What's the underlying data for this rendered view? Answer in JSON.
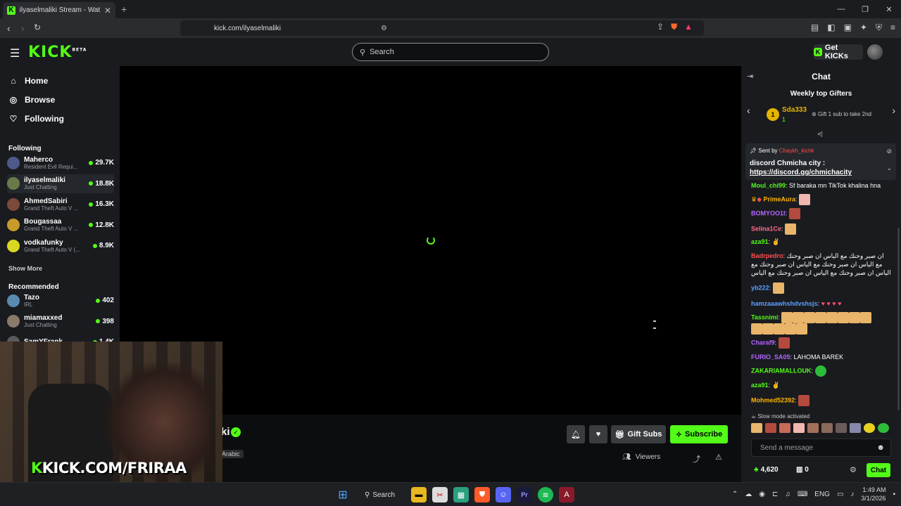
{
  "browser": {
    "tab_title": "ilyaselmaliki Stream - Watch Live",
    "url": "kick.com/ilyaselmaliki"
  },
  "header": {
    "logo_text": "KICK",
    "logo_badge": "BETA",
    "search_placeholder": "Search",
    "get_kicks_label": "Get KICKs"
  },
  "sidebar": {
    "nav": [
      {
        "label": "Home",
        "icon": "home-icon"
      },
      {
        "label": "Browse",
        "icon": "compass-icon"
      },
      {
        "label": "Following",
        "icon": "heart-icon"
      }
    ],
    "following_title": "Following",
    "following": [
      {
        "name": "Maherco",
        "game": "Resident Evil Requi...",
        "viewers": "29.7K",
        "color": "#4b5a8a"
      },
      {
        "name": "ilyaselmaliki",
        "game": "Just Chatting",
        "viewers": "18.8K",
        "color": "#6a7a4a"
      },
      {
        "name": "AhmedSabiri",
        "game": "Grand Theft Auto V ...",
        "viewers": "16.3K",
        "color": "#7a4a3a"
      },
      {
        "name": "Bougassaa",
        "game": "Grand Theft Auto V ...",
        "viewers": "12.8K",
        "color": "#c89a2a"
      },
      {
        "name": "vodkafunky",
        "game": "Grand Theft Auto V (...",
        "viewers": "8.9K",
        "color": "#d8d820"
      }
    ],
    "show_more": "Show More",
    "recommended_title": "Recommended",
    "recommended": [
      {
        "name": "Tazo",
        "game": "IRL",
        "viewers": "402",
        "color": "#5a8ab0"
      },
      {
        "name": "miamaxxed",
        "game": "Just Chatting",
        "viewers": "398",
        "color": "#8a7a6a"
      },
      {
        "name": "SamYFrank",
        "game": "",
        "viewers": "1.4K",
        "color": "#5a5a5a"
      }
    ]
  },
  "stream": {
    "name_visible": "ki",
    "language_tag": "Arabic",
    "gift_subs_label": "Gift Subs",
    "subscribe_label": "Subscribe",
    "viewers_label": "Viewers",
    "webcam_text_k": "K",
    "webcam_text": "KICK.COM/FRIRAA"
  },
  "chat": {
    "title": "Chat",
    "gifters_title": "Weekly top Gifters",
    "top_gifter": {
      "rank": "1",
      "name": "Sda333",
      "count": "1"
    },
    "gift_hint": "Gift 1 sub to take 2nd",
    "pinned": {
      "sent_by": "Sent by",
      "user": "Chaykh_kichk",
      "text": "discord Chmicha city :",
      "link": "https://discord.gg/chmichacity"
    },
    "messages": [
      {
        "user": "BOMYOO1I",
        "color": "#b366ff",
        "text": ""
      },
      {
        "user": "Moul_chi99",
        "color": "#53fc18",
        "text": "Sf baraka mn TikTok khalina hna"
      },
      {
        "user": "PrimeAura",
        "color": "#ffb400",
        "text": ""
      },
      {
        "user": "BOMYOO1I",
        "color": "#b366ff",
        "text": ""
      },
      {
        "user": "Selina1Ce",
        "color": "#ff6b8a",
        "text": ""
      },
      {
        "user": "aza91",
        "color": "#53fc18",
        "text": ""
      },
      {
        "user": "Badrpedro",
        "color": "#ff4d4d",
        "text": "ان صبر وحنك مع الياس ان صبر وحنك مع الياس ان صبر وحنك مع الياس ان صبر وحنك مع الياس ان صبر وحنك مع الياس ان صبر وحنك مع الياس"
      },
      {
        "user": "yb222",
        "color": "#5aa0ff",
        "text": ""
      },
      {
        "user": "hamzaaawhshdvshsjs",
        "color": "#5aa0ff",
        "text": ""
      },
      {
        "user": "Tassnimi",
        "color": "#53fc18",
        "text": ""
      },
      {
        "user": "Charaf9",
        "color": "#b366ff",
        "text": ""
      },
      {
        "user": "FURIO_SA05",
        "color": "#b366ff",
        "text": "LAHOMA BAREK"
      },
      {
        "user": "ZAKARIAMALLOUK",
        "color": "#53fc18",
        "text": ""
      },
      {
        "user": "aza91",
        "color": "#53fc18",
        "text": ""
      },
      {
        "user": "Mohmed52392",
        "color": "#ffb400",
        "text": ""
      }
    ],
    "slow_mode": "Slow mode activated",
    "input_placeholder": "Send a message",
    "kicks_balance": "4,620",
    "gift_balance": "0",
    "chat_button": "Chat"
  },
  "taskbar": {
    "search_label": "Search",
    "language": "ENG",
    "time": "1:49 AM",
    "date": "3/1/2026"
  },
  "colors": {
    "accent": "#53fc18",
    "bg": "#0b0e0f",
    "panel": "#191b1f"
  }
}
